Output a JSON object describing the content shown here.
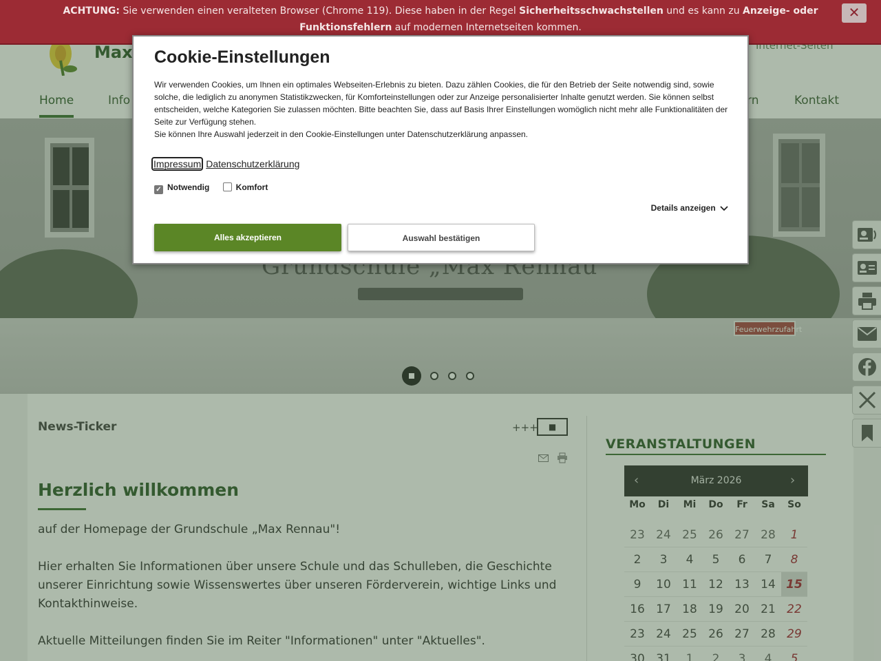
{
  "warning": {
    "prefix": "ACHTUNG:",
    "text1": " Sie verwenden einen veralteten Browser (Chrome 119). Diese haben in der Regel ",
    "bold1": "Sicherheitsschwachstellen",
    "text2": " und es kann zu ",
    "bold2": "Anzeige- oder Funktionsfehlern",
    "text3": " auf modernen Internetseiten kommen.",
    "close_label": "✕"
  },
  "header": {
    "brand": "Max",
    "top_link": "Internet-Seiten"
  },
  "nav": {
    "home": "Home",
    "info": "Info",
    "partial": "rn",
    "kontakt": "Kontakt"
  },
  "hero": {
    "title": "Grundschule „Max Rennau\"",
    "plaque": "Feuerwehrzufahrt"
  },
  "news": {
    "label": "News-Ticker",
    "plus": "+++",
    "stop_label": "■"
  },
  "content": {
    "heading": "Herzlich willkommen",
    "p1": "auf der Homepage der Grundschule „Max Rennau\"!",
    "p2": "Hier erhalten Sie Informationen über unsere Schule und das Schulleben, die Geschichte unserer Einrichtung sowie Wissenswertes über unseren Förderverein, wichtige Links und Kontakthinweise.",
    "p3": "Aktuelle Mitteilungen finden Sie im Reiter \"Informationen\" unter \"Aktuelles\"."
  },
  "events": {
    "title": "VERANSTALTUNGEN",
    "month": "März 2026",
    "prev": "‹",
    "next": "›",
    "dow": [
      "Mo",
      "Di",
      "Mi",
      "Do",
      "Fr",
      "Sa",
      "So"
    ],
    "weeks": [
      [
        "23",
        "24",
        "25",
        "26",
        "27",
        "28",
        "1"
      ],
      [
        "2",
        "3",
        "4",
        "5",
        "6",
        "7",
        "8"
      ],
      [
        "9",
        "10",
        "11",
        "12",
        "13",
        "14",
        "15"
      ],
      [
        "16",
        "17",
        "18",
        "19",
        "20",
        "21",
        "22"
      ],
      [
        "23",
        "24",
        "25",
        "26",
        "27",
        "28",
        "29"
      ],
      [
        "30",
        "31",
        "1",
        "2",
        "3",
        "4",
        "5"
      ]
    ],
    "today": "15"
  },
  "cookie": {
    "title": "Cookie-Einstellungen",
    "text": "Wir verwenden Cookies, um Ihnen ein optimales Webseiten-Erlebnis zu bieten. Dazu zählen Cookies, die für den Betrieb der Seite notwendig sind, sowie solche, die lediglich zu anonymen Statistikzwecken, für Komforteinstellungen oder zur Anzeige personalisierter Inhalte genutzt werden. Sie können selbst entscheiden, welche Kategorien Sie zulassen möchten. Bitte beachten Sie, dass auf Basis Ihrer Einstellungen womöglich nicht mehr alle Funktionalitäten der Seite zur Verfügung stehen.",
    "text2": "Sie können Ihre Auswahl jederzeit in den Cookie-Einstellungen unter Datenschutzerklärung anpassen.",
    "impressum": "Impressum",
    "datenschutz": "Datenschutzerklärung",
    "notwendig": "Notwendig",
    "komfort": "Komfort",
    "details": "Details anzeigen",
    "accept_all": "Alles akzeptieren",
    "confirm": "Auswahl bestätigen",
    "notwendig_checked": true,
    "komfort_checked": false
  },
  "colors": {
    "brand_green": "#2f5a2b",
    "accept_green": "#5b8626",
    "warning_red": "#9c2b34"
  },
  "icons": [
    "contact-card-icon",
    "address-card-icon",
    "printer-icon",
    "mail-icon",
    "facebook-icon",
    "x-icon",
    "bookmark-icon"
  ]
}
